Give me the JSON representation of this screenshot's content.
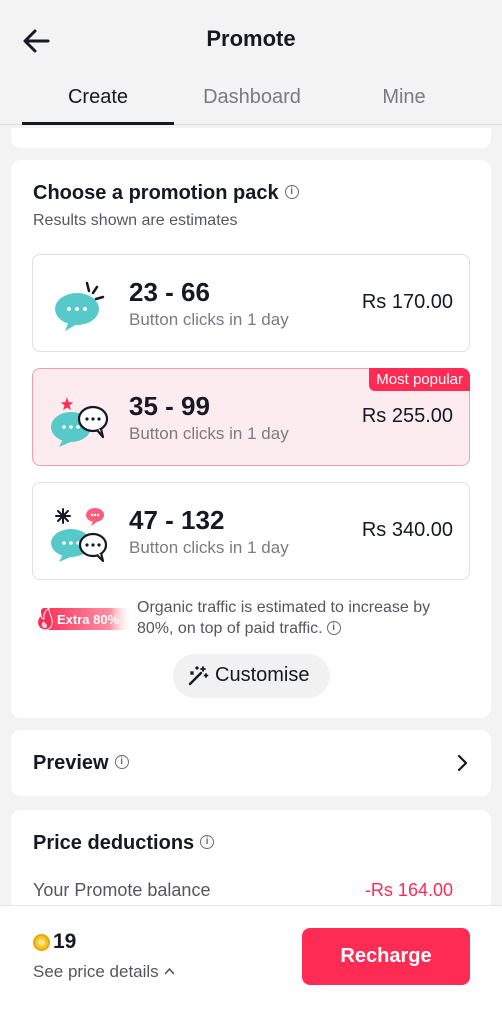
{
  "header": {
    "title": "Promote",
    "back_icon": "arrow-left-icon"
  },
  "tabs": [
    {
      "label": "Create",
      "active": true
    },
    {
      "label": "Dashboard",
      "active": false
    },
    {
      "label": "Mine",
      "active": false
    }
  ],
  "pack_section": {
    "title": "Choose a promotion pack",
    "subtitle": "Results shown are estimates",
    "packs": [
      {
        "range": "23 - 66",
        "desc": "Button clicks in 1 day",
        "price": "Rs 170.00",
        "badge": "",
        "selected": false,
        "icon": "chat-bubble-icon"
      },
      {
        "range": "35 - 99",
        "desc": "Button clicks in 1 day",
        "price": "Rs 255.00",
        "badge": "Most popular",
        "selected": true,
        "icon": "chat-bubbles-icon"
      },
      {
        "range": "47 - 132",
        "desc": "Button clicks in 1 day",
        "price": "Rs 340.00",
        "badge": "",
        "selected": false,
        "icon": "chat-bubbles-multi-icon"
      }
    ],
    "extra_badge": "Extra 80%",
    "extra_text": "Organic traffic is estimated to increase by 80%, on top of paid traffic.",
    "customise_label": "Customise"
  },
  "preview": {
    "title": "Preview"
  },
  "price_deductions": {
    "title": "Price deductions",
    "balance_label": "Your Promote balance",
    "balance_value": "-Rs 164.00"
  },
  "footer": {
    "coin_count": "19",
    "price_details": "See price details",
    "recharge_label": "Recharge"
  },
  "colors": {
    "accent": "#fe2c55",
    "selected_bg": "#fdecef",
    "teal_icon": "#58c9c9"
  }
}
